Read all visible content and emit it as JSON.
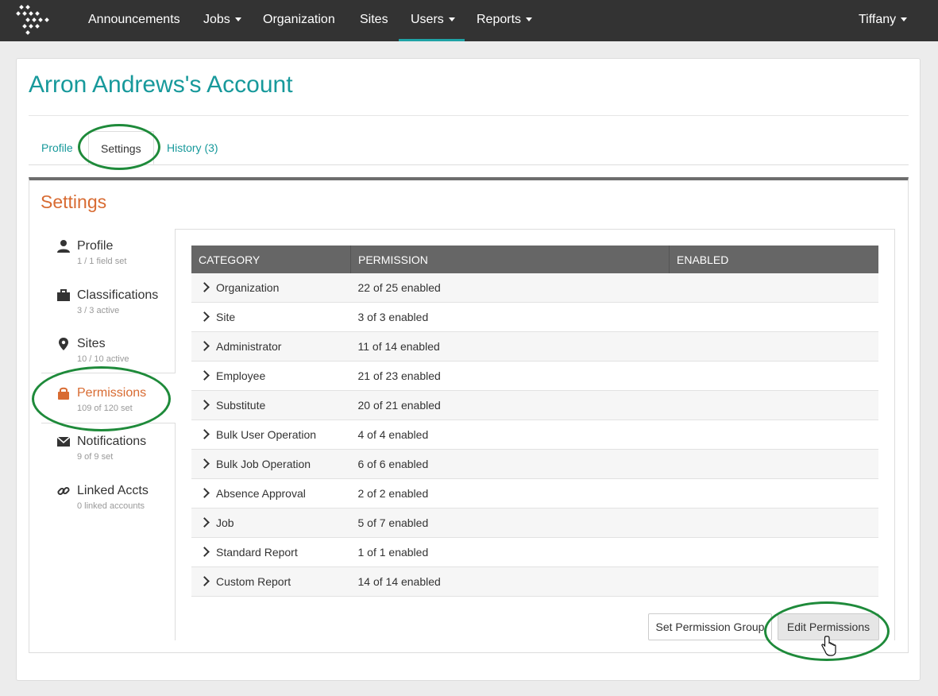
{
  "nav": {
    "items": [
      {
        "label": "Announcements"
      },
      {
        "label": "Jobs"
      },
      {
        "label": "Organization"
      },
      {
        "label": "Sites"
      },
      {
        "label": "Users"
      },
      {
        "label": "Reports"
      }
    ],
    "user": "Tiffany",
    "active": "Users"
  },
  "page": {
    "title": "Arron Andrews's Account"
  },
  "tabs": [
    {
      "label": "Profile"
    },
    {
      "label": "Settings"
    },
    {
      "label": "History (3)"
    }
  ],
  "settings": {
    "heading": "Settings",
    "sidebar": [
      {
        "label": "Profile",
        "sub": "1 / 1 field set",
        "icon": "user-icon"
      },
      {
        "label": "Classifications",
        "sub": "3 / 3 active",
        "icon": "briefcase-icon"
      },
      {
        "label": "Sites",
        "sub": "10 / 10 active",
        "icon": "map-marker-icon"
      },
      {
        "label": "Permissions",
        "sub": "109 of 120 set",
        "icon": "lock-icon"
      },
      {
        "label": "Notifications",
        "sub": "9 of 9 set",
        "icon": "envelope-icon"
      },
      {
        "label": "Linked Accts",
        "sub": "0 linked accounts",
        "icon": "link-icon"
      }
    ]
  },
  "table": {
    "headers": {
      "category": "CATEGORY",
      "permission": "PERMISSION",
      "enabled": "ENABLED"
    },
    "rows": [
      {
        "category": "Organization",
        "permission": "22 of 25 enabled"
      },
      {
        "category": "Site",
        "permission": "3 of 3 enabled"
      },
      {
        "category": "Administrator",
        "permission": "11 of 14 enabled"
      },
      {
        "category": "Employee",
        "permission": "21 of 23 enabled"
      },
      {
        "category": "Substitute",
        "permission": "20 of 21 enabled"
      },
      {
        "category": "Bulk User Operation",
        "permission": "4 of 4 enabled"
      },
      {
        "category": "Bulk Job Operation",
        "permission": "6 of 6 enabled"
      },
      {
        "category": "Absence Approval",
        "permission": "2 of 2 enabled"
      },
      {
        "category": "Job",
        "permission": "5 of 7 enabled"
      },
      {
        "category": "Standard Report",
        "permission": "1 of 1 enabled"
      },
      {
        "category": "Custom Report",
        "permission": "14 of 14 enabled"
      }
    ]
  },
  "buttons": {
    "set_group": "Set Permission Group",
    "edit": "Edit Permissions"
  },
  "colors": {
    "nav_bg": "#333333",
    "accent_teal": "#17999b",
    "accent_orange": "#d86b32",
    "annotation_green": "#1e8a3a"
  }
}
